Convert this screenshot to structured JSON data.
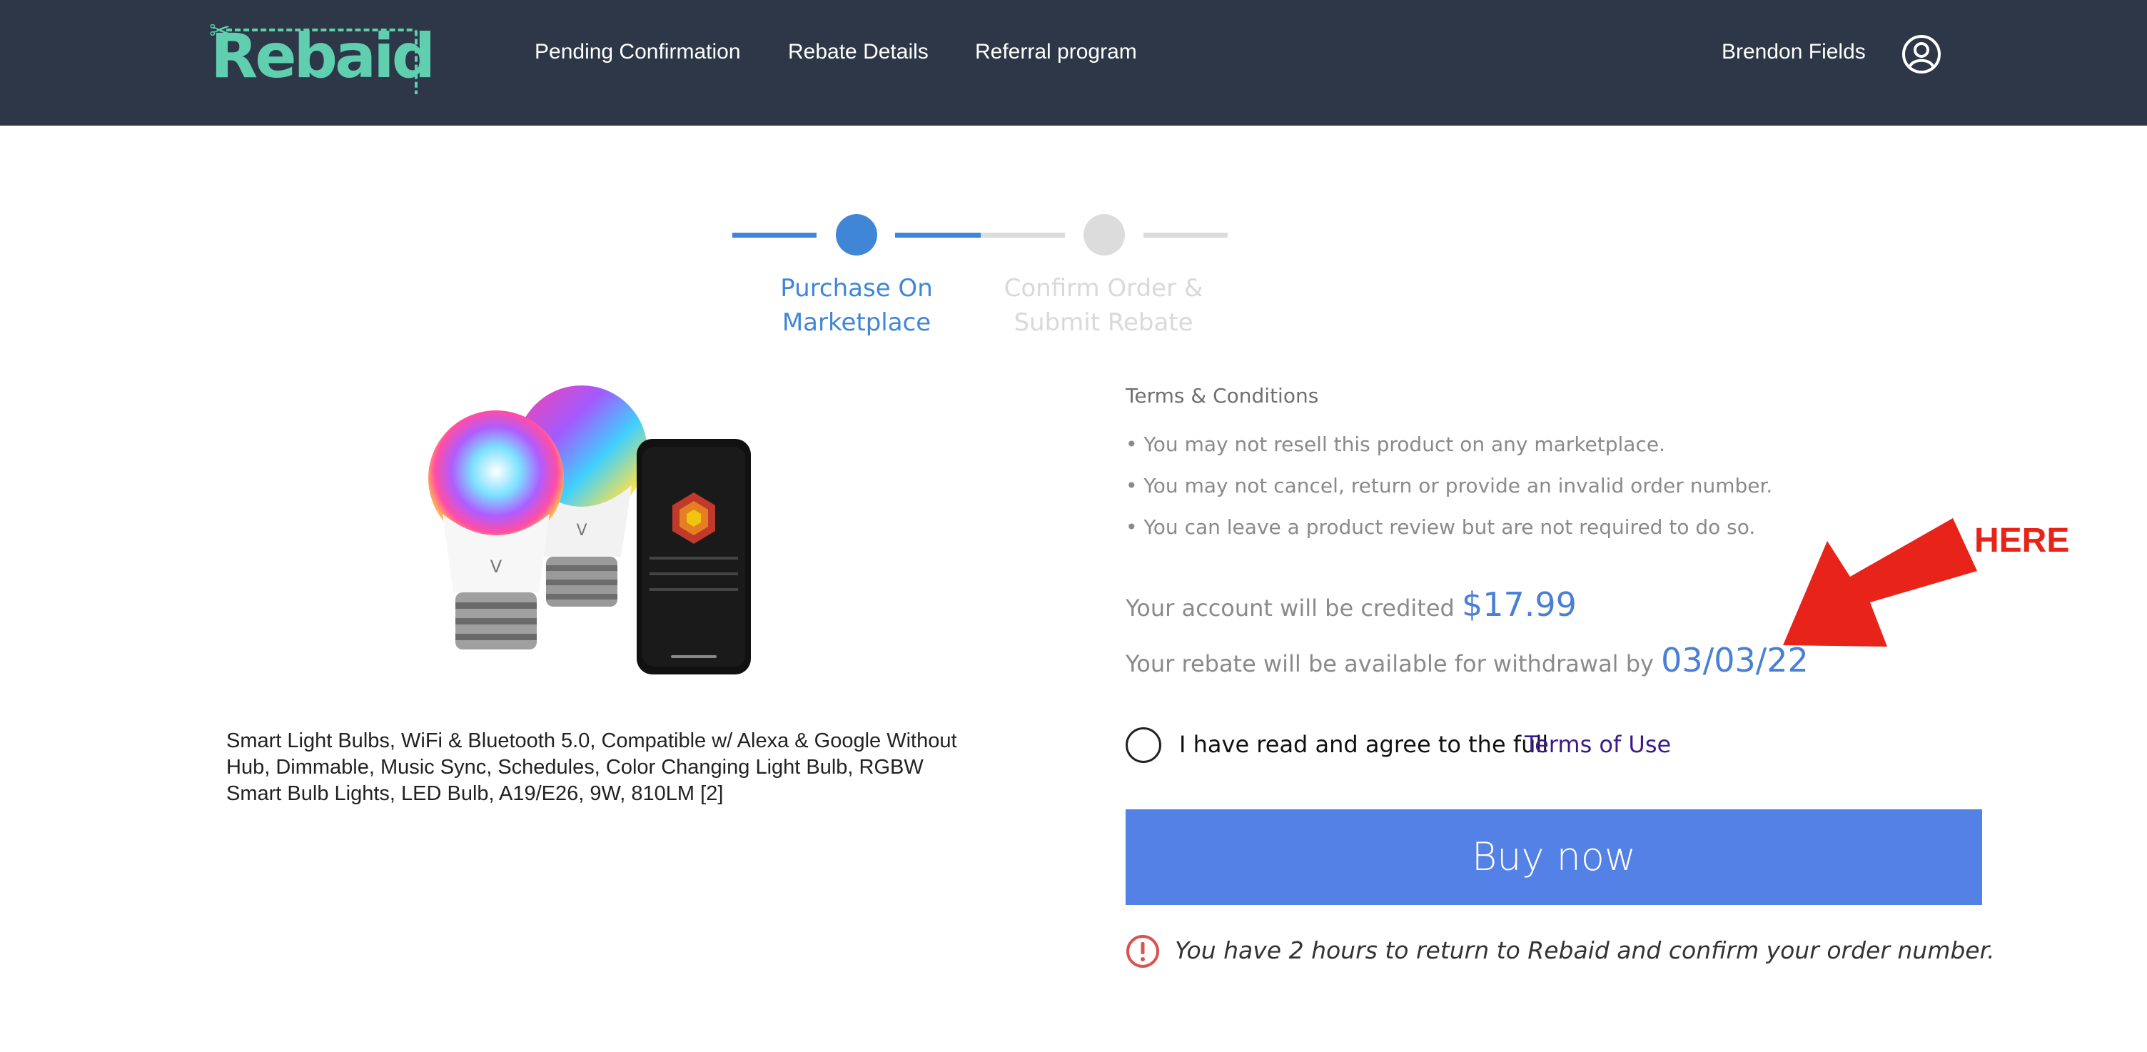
{
  "header": {
    "logo_text": "Rebaid",
    "nav": [
      "Pending Confirmation",
      "Rebate Details",
      "Referral program"
    ],
    "user_name": "Brendon Fields"
  },
  "stepper": {
    "steps": [
      "Purchase On Marketplace",
      "Confirm Order & Submit Rebate"
    ],
    "step1_line1": "Purchase On",
    "step1_line2": "Marketplace",
    "step2_line1": "Confirm Order &",
    "step2_line2": "Submit Rebate",
    "active_step": 1,
    "active_color": "#3f86d6",
    "inactive_color": "#dcdcdc"
  },
  "product": {
    "title": "Smart Light Bulbs, WiFi & Bluetooth 5.0, Compatible w/ Alexa & Google Without Hub, Dimmable, Music Sync, Schedules, Color Changing Light Bulb, RGBW Smart Bulb Lights, LED Bulb, A19/E26, 9W, 810LM [2]",
    "title_line1": "Smart Light Bulbs, WiFi & Bluetooth 5.0, Compatible w/ Alexa & Google Without",
    "title_line2": "Hub, Dimmable, Music Sync, Schedules, Color Changing Light Bulb, RGBW",
    "title_line3": "Smart Bulb Lights, LED Bulb, A19/E26, 9W, 810LM [2]"
  },
  "terms": {
    "title": "Terms & Conditions",
    "bullets": [
      "• You may not resell this product on any marketplace.",
      "• You may not cancel, return or provide an invalid order number.",
      "• You can leave a product review but are not required to do so."
    ]
  },
  "credit": {
    "prefix": "Your account will be credited",
    "amount": "$17.99",
    "withdraw_prefix": "Your rebate will be available for withdrawal by",
    "withdraw_date": "03/03/22"
  },
  "annotation": {
    "label": "HERE",
    "color": "#e8231a"
  },
  "agreement": {
    "text": "I have read and agree to the full",
    "link": "Terms of Use",
    "checked": false
  },
  "buy_button": {
    "label": "Buy now",
    "color": "#5381e6"
  },
  "warning": {
    "text": "You have 2 hours to return to Rebaid and confirm your order number."
  }
}
